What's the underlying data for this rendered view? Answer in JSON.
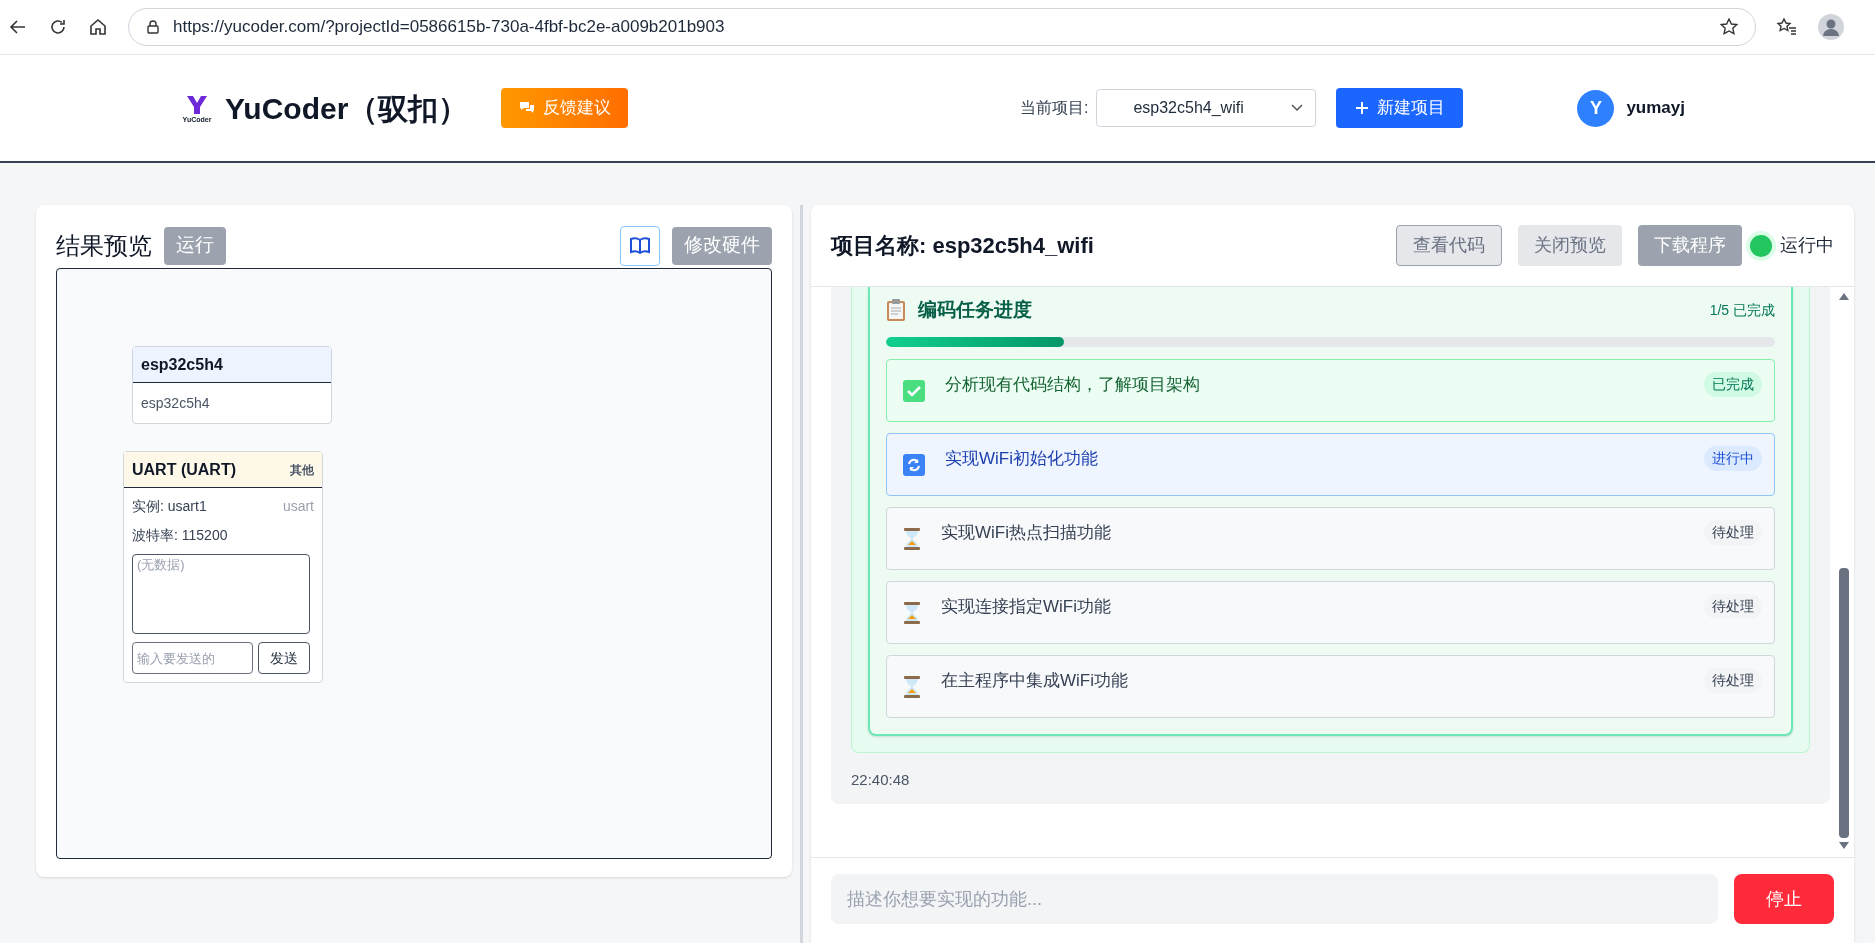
{
  "browser": {
    "url": "https://yucoder.com/?projectId=0586615b-730a-4fbf-bc2e-a009b201b903"
  },
  "header": {
    "logo_caption": "YuCoder",
    "brand": "YuCoder（驭扣）",
    "feedback_button": "反馈建议",
    "project_label": "当前项目:",
    "project_select": "esp32c5h4_wifi",
    "new_project_button": "新建项目",
    "user": {
      "initial": "Y",
      "name": "yumayj"
    }
  },
  "preview": {
    "title": "结果预览",
    "run_button": {
      "label": "运行",
      "disabled": true
    },
    "modify_button": {
      "label": "修改硬件",
      "disabled": true
    },
    "nodes": [
      {
        "kind": "chip",
        "title": "esp32c5h4",
        "body": "esp32c5h4"
      },
      {
        "kind": "uart",
        "title": "UART (UART)",
        "category": "其他",
        "instance": "实例: usart1",
        "type": "usart",
        "baud": "波特率: 115200",
        "output_placeholder": "(无数据)",
        "input_placeholder": "输入要发送的",
        "send_button": "发送"
      }
    ]
  },
  "project": {
    "title": "项目名称: esp32c5h4_wifi",
    "buttons": [
      {
        "label": "查看代码",
        "kind": "outline"
      },
      {
        "label": "关闭预览",
        "kind": "muted"
      },
      {
        "label": "下载程序",
        "kind": "disabled"
      }
    ],
    "status": {
      "label": "运行中",
      "on": true
    },
    "tasks": {
      "title": "编码任务进度",
      "count": "1/5 已完成",
      "level": 0.2,
      "items": [
        {
          "text": "分析现有代码结构，了解项目架构",
          "kind": "done",
          "badge": "已完成"
        },
        {
          "text": "实现WiFi初始化功能",
          "kind": "running",
          "badge": "进行中"
        },
        {
          "text": "实现WiFi热点扫描功能",
          "kind": "pending",
          "badge": "待处理"
        },
        {
          "text": "实现连接指定WiFi功能",
          "kind": "pending",
          "badge": "待处理"
        },
        {
          "text": "在主程序中集成WiFi功能",
          "kind": "pending",
          "badge": "待处理"
        }
      ]
    },
    "time": "22:40:48",
    "input_placeholder": "描述你想要实现的功能...",
    "stop_button": "停止"
  }
}
